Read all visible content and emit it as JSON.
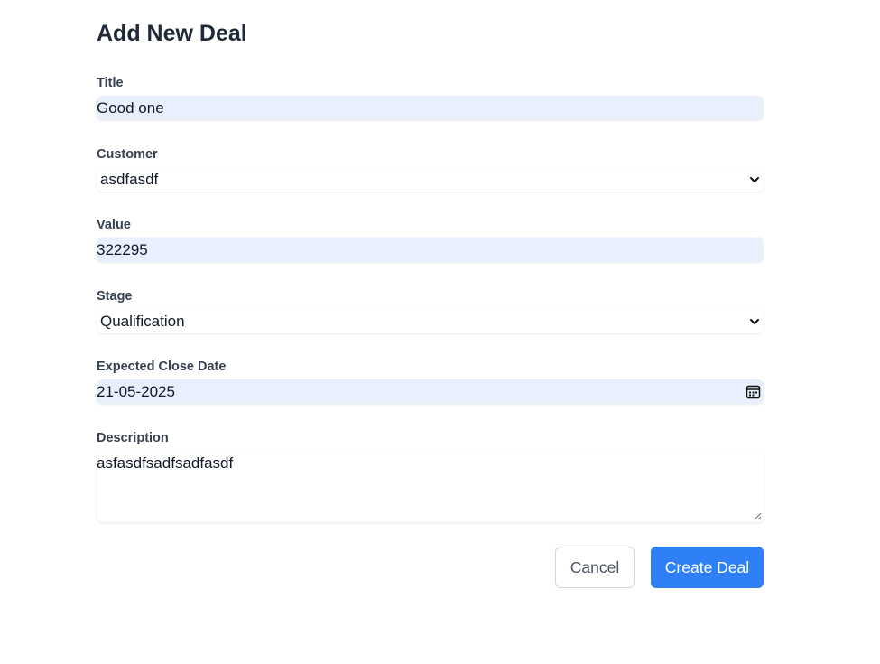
{
  "page": {
    "title": "Add New Deal"
  },
  "form": {
    "title": {
      "label": "Title",
      "value": "Good one"
    },
    "customer": {
      "label": "Customer",
      "value": "asdfasdf"
    },
    "value": {
      "label": "Value",
      "value": "322295"
    },
    "stage": {
      "label": "Stage",
      "value": "Qualification"
    },
    "expected_close_date": {
      "label": "Expected Close Date",
      "value": "21-05-2025"
    },
    "description": {
      "label": "Description",
      "value": "asfasdfsadfsadfasdf"
    }
  },
  "actions": {
    "cancel_label": "Cancel",
    "create_label": "Create Deal"
  },
  "icons": {
    "select_arrow": "chevron-down-icon",
    "calendar": "calendar-icon",
    "resize": "resize-handle-icon"
  },
  "colors": {
    "primary": "#2f80f6",
    "autofill_bg": "#e8f0fe",
    "heading": "#1f2937",
    "label": "#374151"
  }
}
